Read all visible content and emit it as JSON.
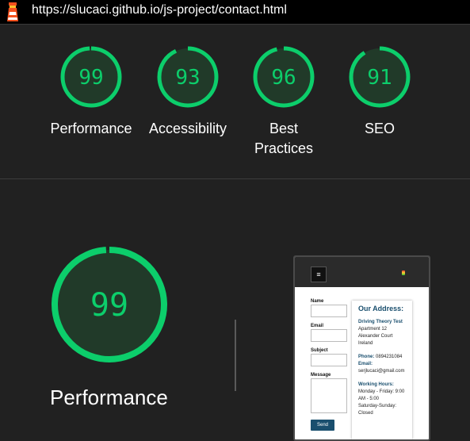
{
  "topbar": {
    "url": "https://slucaci.github.io/js-project/contact.html"
  },
  "colors": {
    "good": "#0cce6b",
    "good_fill": "#213a29",
    "background": "#212121"
  },
  "scores": [
    {
      "value": "99",
      "label": "Performance",
      "score": 0.99
    },
    {
      "value": "93",
      "label": "Accessibility",
      "score": 0.93
    },
    {
      "value": "96",
      "label": "Best Practices",
      "score": 0.96
    },
    {
      "value": "91",
      "label": "SEO",
      "score": 0.91
    }
  ],
  "main": {
    "score": "99",
    "score_fraction": 0.99,
    "label": "Performance"
  },
  "thumbnail": {
    "menu_icon": "≡",
    "form": {
      "name_label": "Name",
      "email_label": "Email",
      "subject_label": "Subject",
      "message_label": "Message",
      "send_label": "Send"
    },
    "address": {
      "title": "Our Address:",
      "company": "Driving Theory Test",
      "line1": "Apartment 12",
      "line2": "Alexander Court",
      "line3": "Ireland",
      "phone_label": "Phone:",
      "phone": "0894231084",
      "email_label": "Email:",
      "email": "serjlucaci@gmail.com",
      "hours_label": "Working Hours:",
      "hours1": "Monday - Friday: 9:00",
      "hours2": "AM - 5:00",
      "hours3": "Saturday-Sunday:",
      "hours4": "Closed"
    }
  }
}
